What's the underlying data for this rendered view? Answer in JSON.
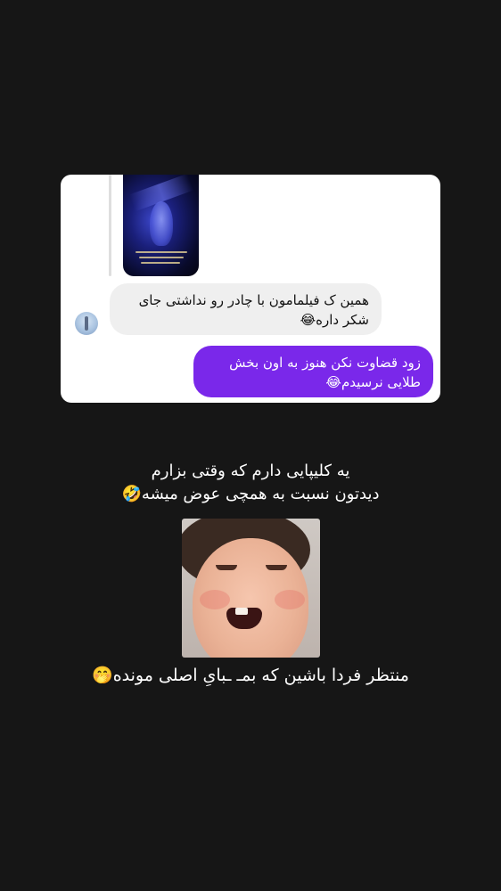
{
  "chat": {
    "received_message": "همین ک فیلمامون با چادر رو نداشتی جای شکر داره😂",
    "sent_message": "زود قضاوت نکن هنوز به اون بخش طلایی نرسیدم😂"
  },
  "captions": {
    "line_1": "یه کلیپایی دارم که وقتی بزارم",
    "line_2": "دیدتون نسبت به همچی عوض میشه🤣",
    "line_3": "منتظر فردا باشین که بمـ ـبایِ اصلی مونده🤭"
  },
  "colors": {
    "background": "#161616",
    "sent_bubble": "#7a28ea",
    "received_bubble": "#efefef"
  },
  "icons": {
    "avatar": "user-avatar"
  }
}
